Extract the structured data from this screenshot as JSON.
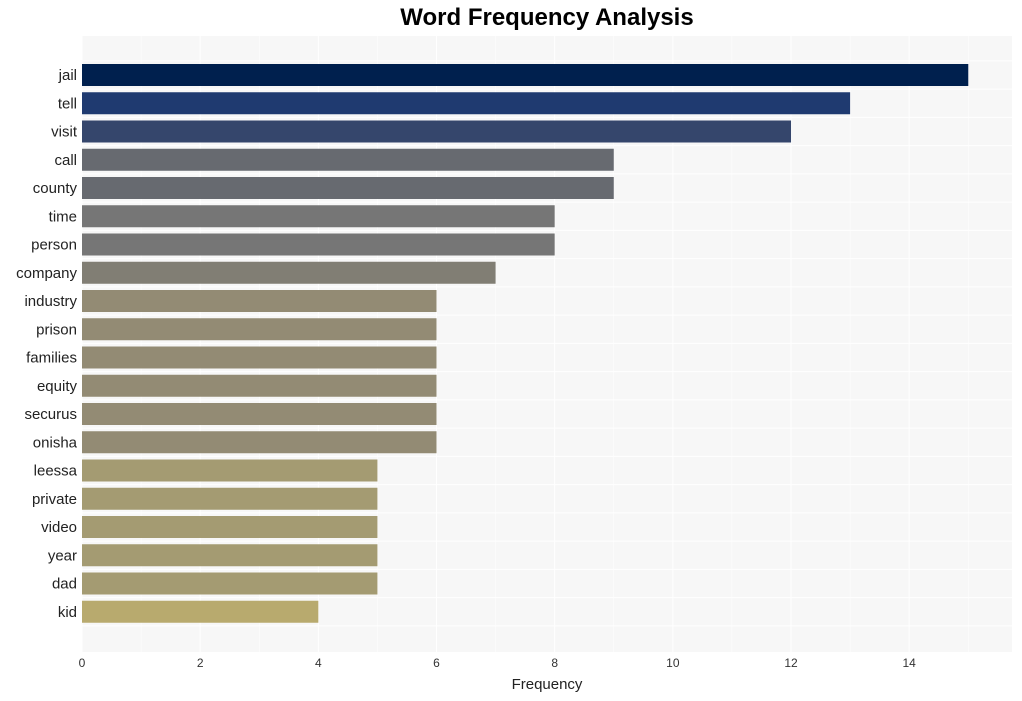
{
  "chart_data": {
    "type": "bar",
    "orientation": "horizontal",
    "title": "Word Frequency Analysis",
    "xlabel": "Frequency",
    "ylabel": "",
    "xlim": [
      0,
      15.74
    ],
    "xticks": [
      0,
      2,
      4,
      6,
      8,
      10,
      12,
      14
    ],
    "grid": true,
    "legend": "none",
    "categories": [
      "jail",
      "tell",
      "visit",
      "call",
      "county",
      "time",
      "person",
      "company",
      "industry",
      "prison",
      "families",
      "equity",
      "securus",
      "onisha",
      "leessa",
      "private",
      "video",
      "year",
      "dad",
      "kid"
    ],
    "values": [
      15,
      13,
      12,
      9,
      9,
      8,
      8,
      7,
      6,
      6,
      6,
      6,
      6,
      6,
      5,
      5,
      5,
      5,
      5,
      4
    ],
    "colors": [
      "#00204e",
      "#1f3a70",
      "#35466c",
      "#676a70",
      "#676a70",
      "#767676",
      "#767676",
      "#817e74",
      "#938b74",
      "#938b74",
      "#938b74",
      "#938b74",
      "#938b74",
      "#938b74",
      "#a49b72",
      "#a49b72",
      "#a49b72",
      "#a49b72",
      "#a49b72",
      "#b8aa6e"
    ]
  },
  "colors": {
    "plot_background": "#f7f7f7",
    "grid": "#ffffff"
  }
}
